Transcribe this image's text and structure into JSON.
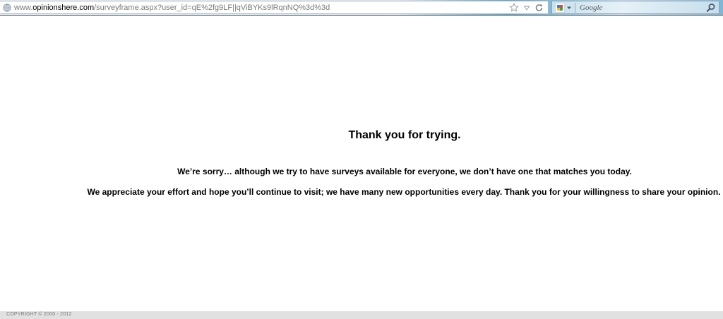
{
  "browser": {
    "url_prefix": "www.",
    "url_host": "opinionshere.com",
    "url_path": "/surveyframe.aspx?user_id=qE%2fg9LF||qViBYKs9lRqnNQ%3d%3d",
    "search_placeholder": "Google",
    "icons": {
      "site": "globe-icon",
      "bookmark": "star-icon",
      "history": "dropdown-triangle-icon",
      "reload": "reload-icon",
      "engine": "google-icon",
      "search": "magnifier-icon"
    }
  },
  "page": {
    "title": "Thank you for trying.",
    "message_1": "We’re sorry… although we try to have surveys available for everyone, we don’t have one that matches you today.",
    "message_2": "We appreciate your effort and hope you’ll continue to visit; we have many new opportunities every day. Thank you for your willingness to share your opinion."
  },
  "footer": {
    "copyright": "COPYRIGHT © 2000 - 2012"
  },
  "colors": {
    "text": "#000000",
    "footer_bg": "#e1e1e1",
    "footer_text": "#7a7a7a"
  }
}
